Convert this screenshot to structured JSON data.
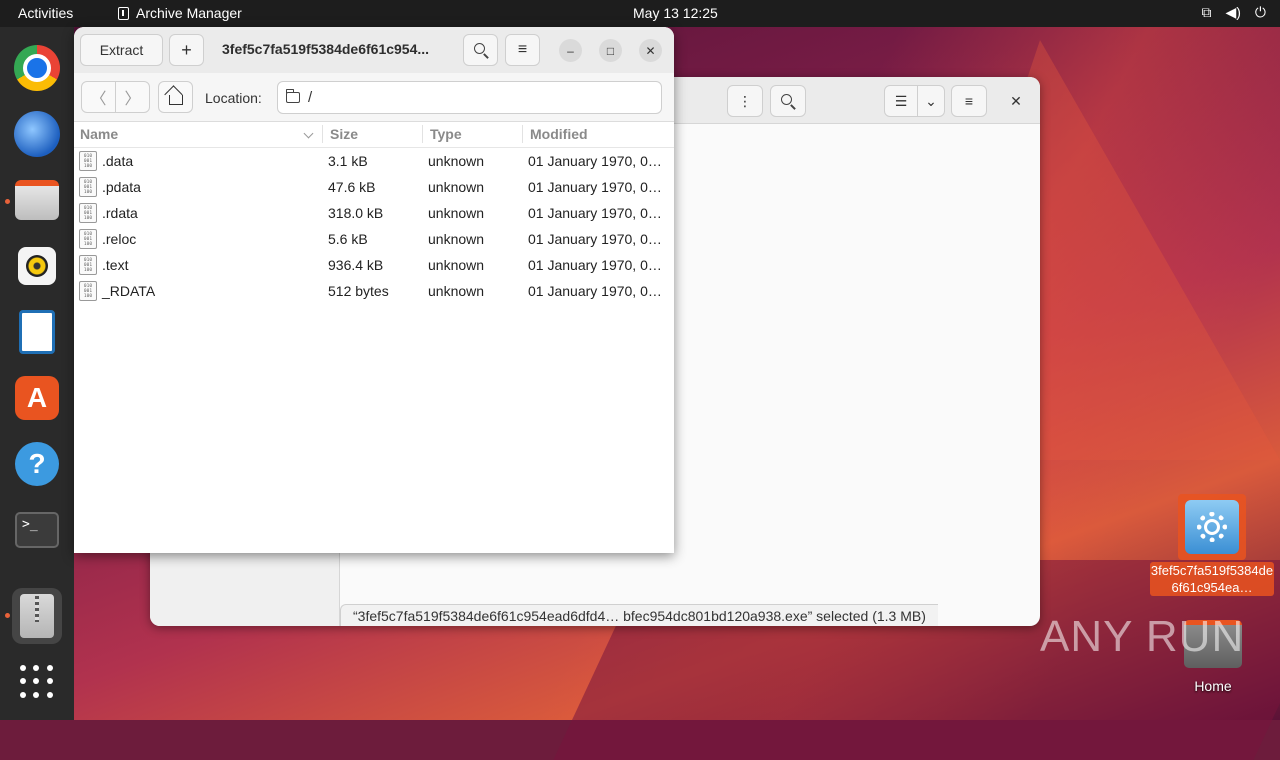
{
  "topbar": {
    "activities": "Activities",
    "app_name": "Archive Manager",
    "clock": "May 13  12:25",
    "tray_icons": [
      "network-icon",
      "volume-icon",
      "power-icon"
    ]
  },
  "dock": {
    "items": [
      "chrome-icon",
      "thunderbird-icon",
      "files-icon",
      "rhythmbox-icon",
      "writer-icon",
      "app-center-icon",
      "help-icon",
      "terminal-icon",
      "archive-manager-icon",
      "show-apps-icon"
    ],
    "terminal_prompt": ">_"
  },
  "file_manager": {
    "status": "“3fef5c7fa519f5384de6f61c954ead6dfd4…  bfec954dc801bd120a938.exe” selected (1.3 MB)"
  },
  "archive_manager": {
    "extract_label": "Extract",
    "add_label": "+",
    "title": "3fef5c7fa519f5384de6f61c954...",
    "location_label": "Location:",
    "location_value": "/",
    "columns": {
      "name": "Name",
      "size": "Size",
      "type": "Type",
      "modified": "Modified"
    },
    "files": [
      {
        "name": ".data",
        "size": "3.1 kB",
        "type": "unknown",
        "modified": "01 January 1970, 0…"
      },
      {
        "name": ".pdata",
        "size": "47.6 kB",
        "type": "unknown",
        "modified": "01 January 1970, 0…"
      },
      {
        "name": ".rdata",
        "size": "318.0 kB",
        "type": "unknown",
        "modified": "01 January 1970, 0…"
      },
      {
        "name": ".reloc",
        "size": "5.6 kB",
        "type": "unknown",
        "modified": "01 January 1970, 0…"
      },
      {
        "name": ".text",
        "size": "936.4 kB",
        "type": "unknown",
        "modified": "01 January 1970, 0…"
      },
      {
        "name": "_RDATA",
        "size": "512 bytes",
        "type": "unknown",
        "modified": "01 January 1970, 0…"
      }
    ]
  },
  "desktop": {
    "exe_label": "3fef5c7fa519f5384de6f61c954ea…",
    "home_label": "Home"
  },
  "watermark": "ANY RUN",
  "colors": {
    "accent": "#e95420",
    "topbar": "#1d1d1d",
    "dock": "#2a2a2a"
  }
}
